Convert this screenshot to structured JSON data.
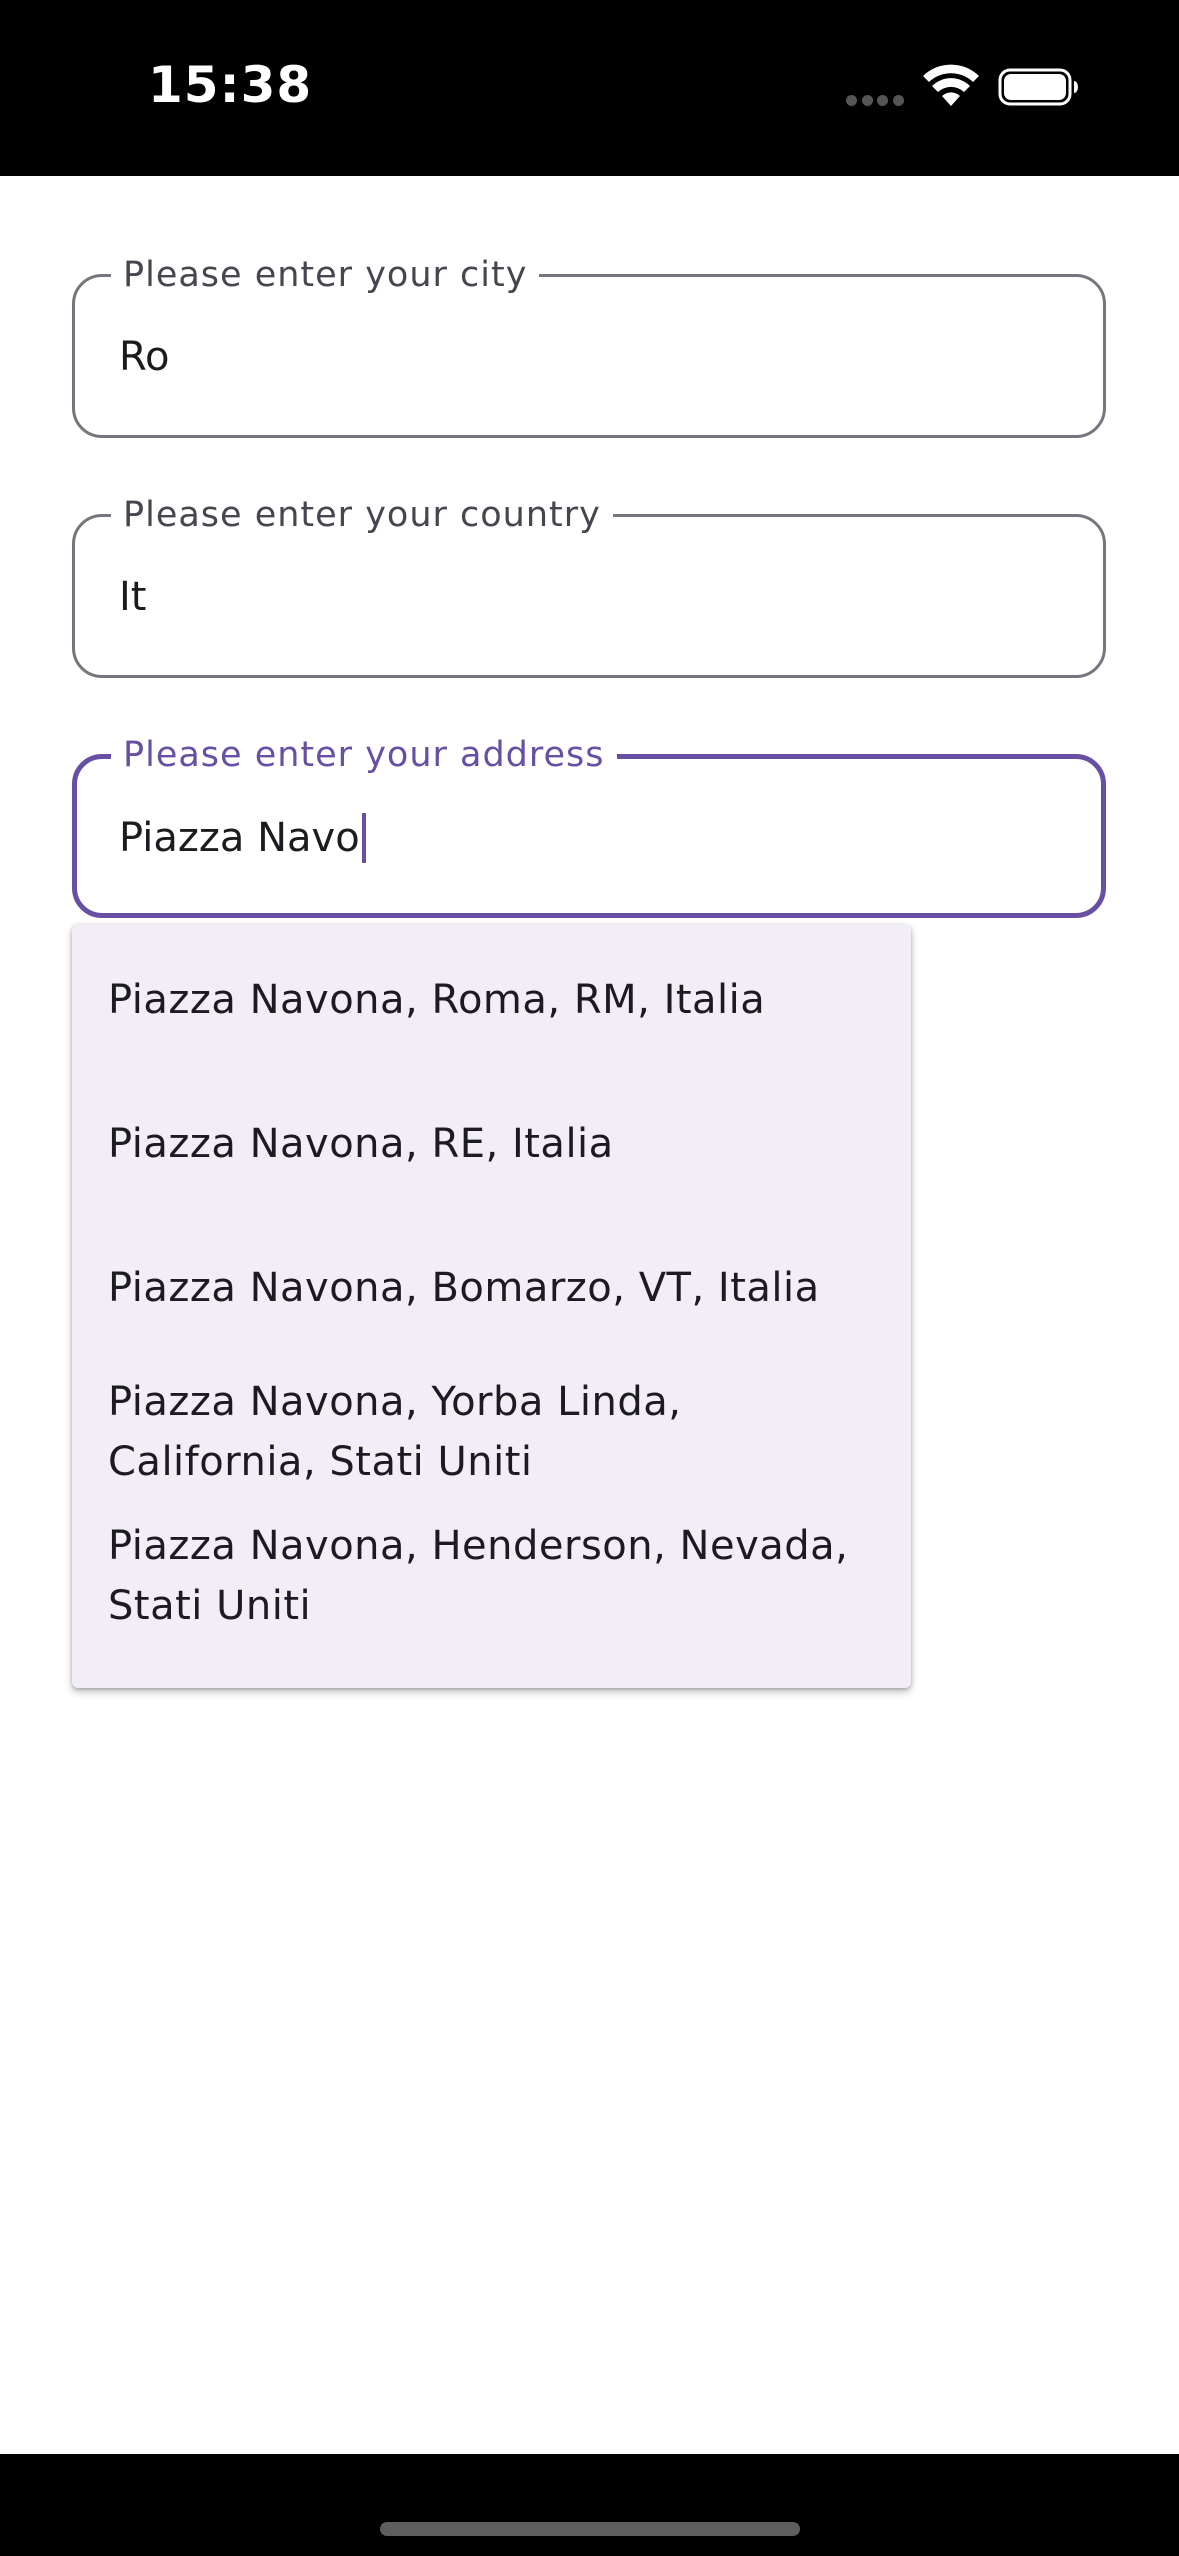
{
  "status_bar": {
    "time": "15:38",
    "icons": [
      "signal-dots-icon",
      "wifi-icon",
      "battery-icon"
    ]
  },
  "form": {
    "city": {
      "label": "Please enter your city",
      "value": "Ro"
    },
    "country": {
      "label": "Please enter your country",
      "value": "It"
    },
    "address": {
      "label": "Please enter your address",
      "value": "Piazza Navo",
      "focused": true
    }
  },
  "suggestions": [
    "Piazza Navona, Roma, RM, Italia",
    "Piazza Navona, RE, Italia",
    "Piazza Navona, Bomarzo, VT, Italia",
    "Piazza Navona, Yorba Linda, California, Stati Uniti",
    "Piazza Navona, Henderson, Nevada, Stati Uniti"
  ],
  "colors": {
    "accent": "#6750a4",
    "outline": "#79747e",
    "dropdown_bg": "#f2edf6",
    "text": "#1c1b1f"
  }
}
